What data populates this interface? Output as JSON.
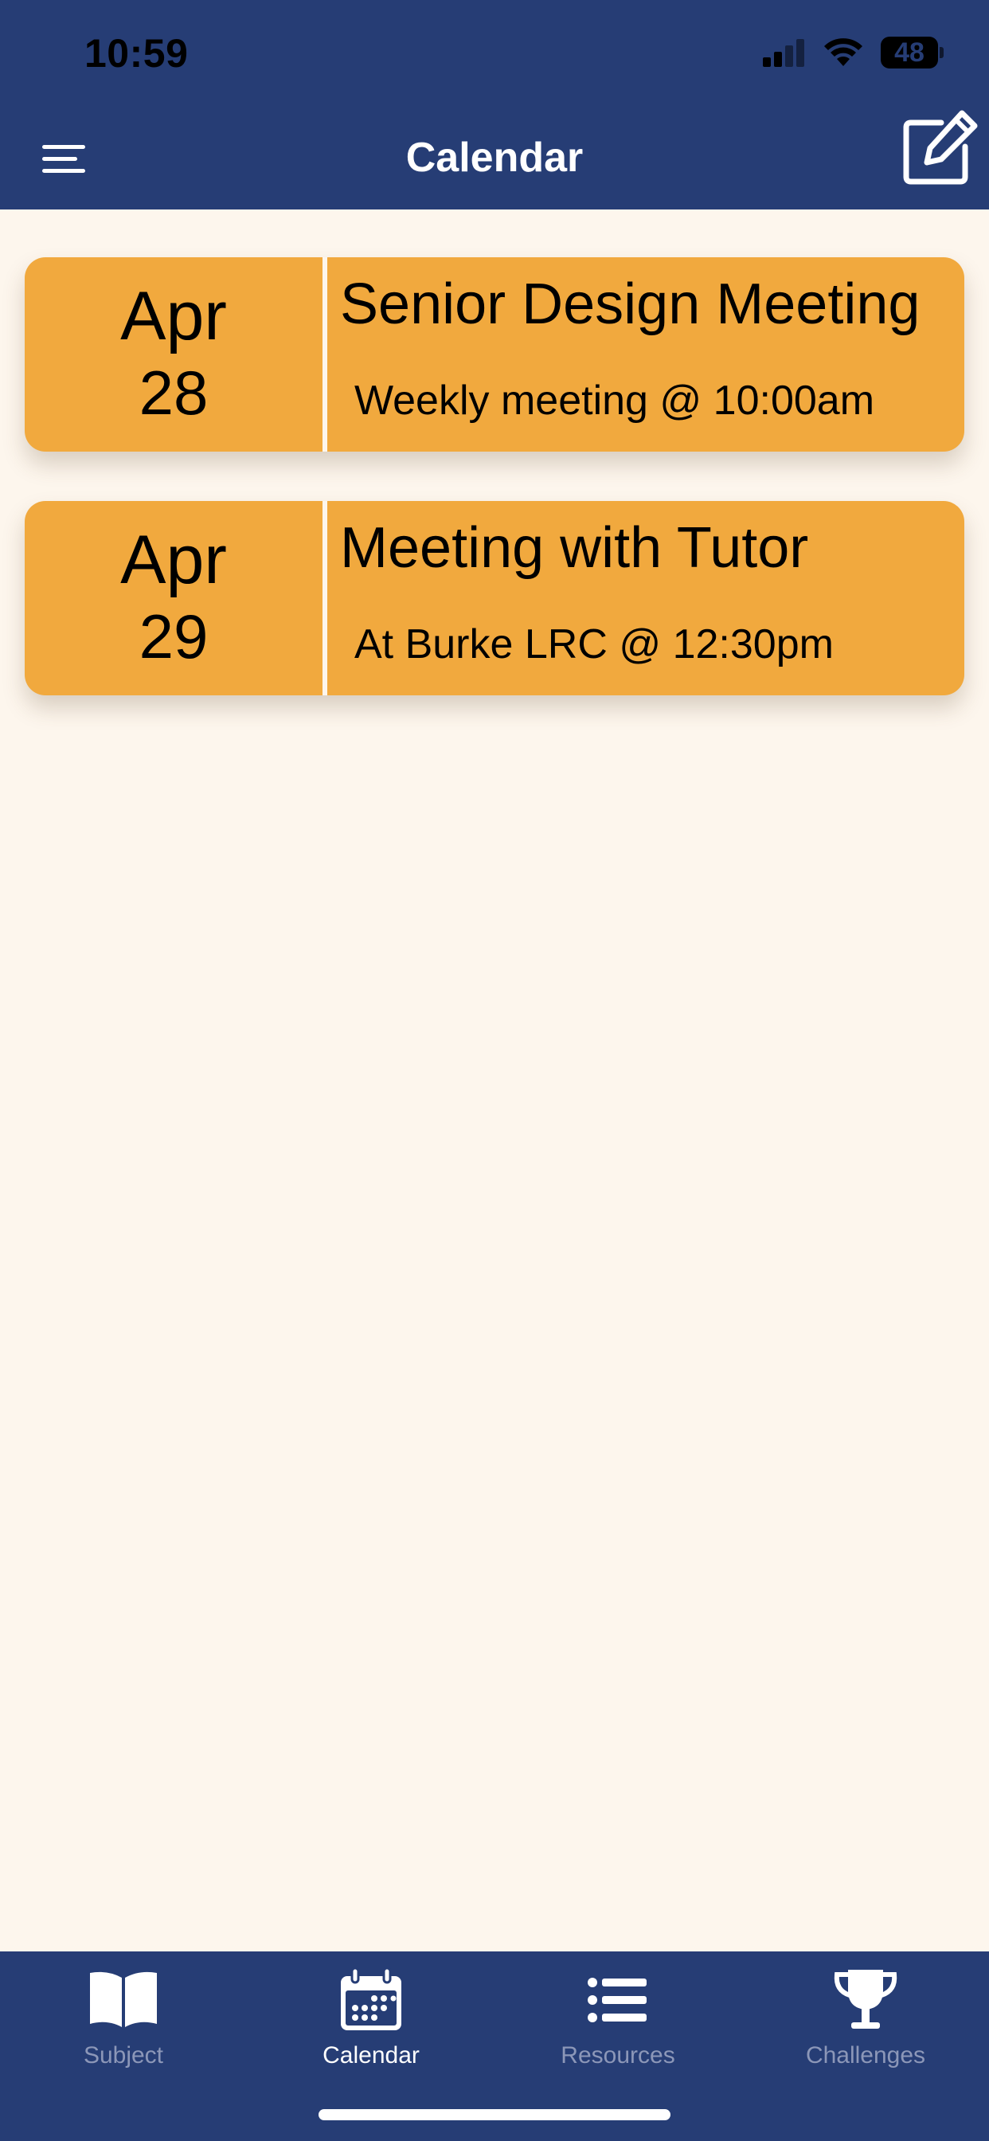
{
  "status_bar": {
    "time": "10:59",
    "battery_level": "48"
  },
  "header": {
    "title": "Calendar",
    "menu_icon": "hamburger-menu-icon",
    "compose_icon": "compose-edit-icon"
  },
  "colors": {
    "header_background": "#263D75",
    "page_background": "#FDF6ED",
    "card_background": "#F1A93E",
    "tab_inactive": "#8C97B8",
    "tab_active": "#FFFFFF"
  },
  "events": [
    {
      "month": "Apr",
      "day": "28",
      "title": "Senior Design Meeting",
      "description": "Weekly meeting @ 10:00am"
    },
    {
      "month": "Apr",
      "day": "29",
      "title": "Meeting with Tutor",
      "description": "At Burke LRC @ 12:30pm"
    }
  ],
  "tabbar": {
    "active": "Calendar",
    "tabs": [
      {
        "label": "Subject",
        "icon": "open-book-icon"
      },
      {
        "label": "Calendar",
        "icon": "calendar-icon"
      },
      {
        "label": "Resources",
        "icon": "list-icon"
      },
      {
        "label": "Challenges",
        "icon": "trophy-icon"
      }
    ]
  }
}
